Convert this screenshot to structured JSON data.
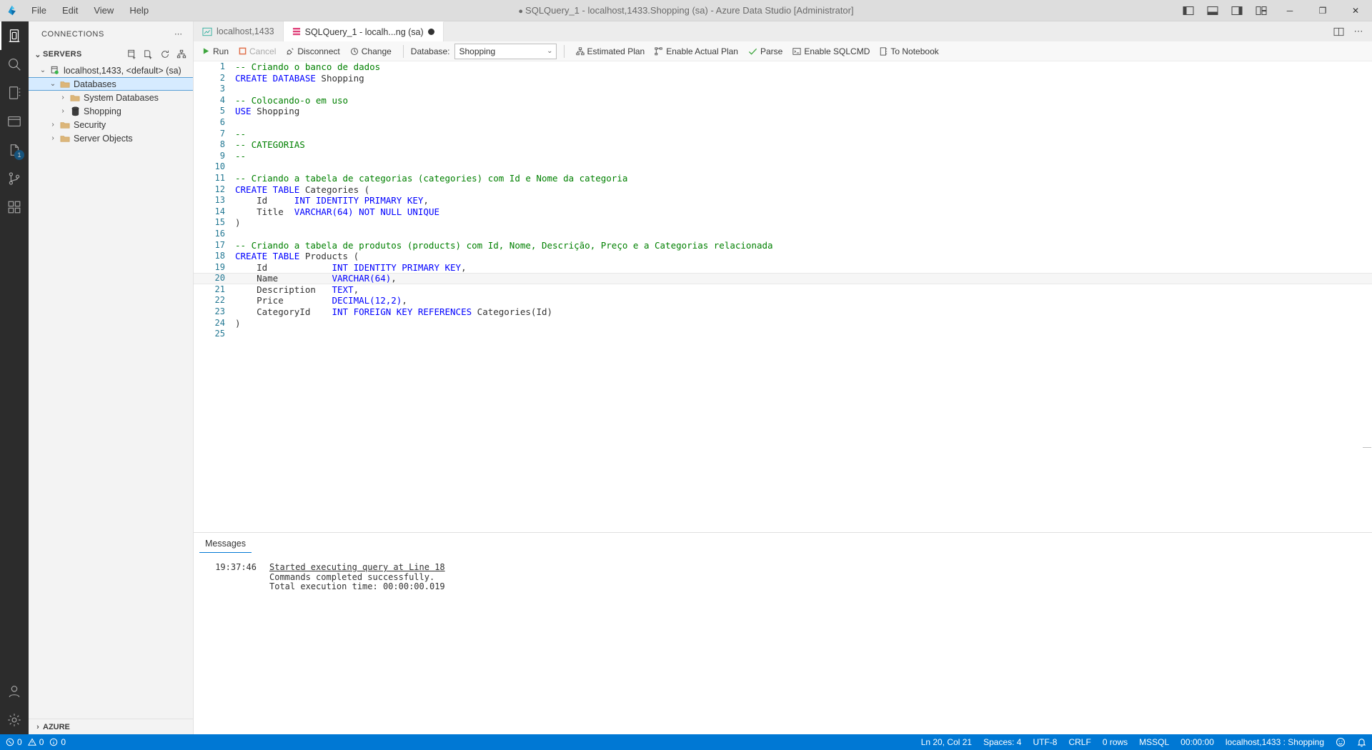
{
  "window": {
    "title": "SQLQuery_1 - localhost,1433.Shopping (sa) - Azure Data Studio [Administrator]",
    "dirty_dot": "●",
    "minimize": "─",
    "maximize": "❐",
    "close": "✕"
  },
  "menu": {
    "items": [
      {
        "label": "File"
      },
      {
        "label": "Edit"
      },
      {
        "label": "View"
      },
      {
        "label": "Help"
      }
    ]
  },
  "activitybar": {
    "items": [
      {
        "name": "servers",
        "icon": "servers-icon",
        "badge": ""
      },
      {
        "name": "search",
        "icon": "search-icon",
        "badge": ""
      },
      {
        "name": "notebooks",
        "icon": "notebook-icon",
        "badge": ""
      },
      {
        "name": "connections-explorer",
        "icon": "explorer-icon",
        "badge": ""
      },
      {
        "name": "source-control",
        "icon": "source-control-icon",
        "badge": "1"
      },
      {
        "name": "git",
        "icon": "git-branch-icon",
        "badge": ""
      },
      {
        "name": "extensions",
        "icon": "extensions-icon",
        "badge": ""
      }
    ],
    "bottom": [
      {
        "name": "accounts",
        "icon": "account-icon"
      },
      {
        "name": "settings",
        "icon": "gear-icon"
      }
    ]
  },
  "sidebar": {
    "header": "CONNECTIONS",
    "overflow": "⋯",
    "section": {
      "label": "SERVERS",
      "chevron": "⌄",
      "actions": [
        {
          "name": "new-connection-icon"
        },
        {
          "name": "new-server-group-icon"
        },
        {
          "name": "refresh-icon"
        },
        {
          "name": "view-as-tree-icon"
        }
      ]
    },
    "tree": [
      {
        "label": "localhost,1433, <default> (sa)",
        "icon": "server-icon",
        "indent": 0,
        "twisty": "⌄",
        "selected": false,
        "status": "connected"
      },
      {
        "label": "Databases",
        "icon": "folder-icon",
        "indent": 1,
        "twisty": "⌄",
        "selected": true
      },
      {
        "label": "System Databases",
        "icon": "folder-icon",
        "indent": 2,
        "twisty": "›",
        "selected": false
      },
      {
        "label": "Shopping",
        "icon": "database-icon",
        "indent": 2,
        "twisty": "›",
        "selected": false
      },
      {
        "label": "Security",
        "icon": "folder-icon",
        "indent": 1,
        "twisty": "›",
        "selected": false
      },
      {
        "label": "Server Objects",
        "icon": "folder-icon",
        "indent": 1,
        "twisty": "›",
        "selected": false
      }
    ],
    "footer": {
      "label": "AZURE",
      "chevron": "›"
    }
  },
  "tabs": [
    {
      "label": "localhost,1433",
      "icon": "dashboard-icon",
      "active": false,
      "dirty": false
    },
    {
      "label": "SQLQuery_1 - localh...ng (sa)",
      "icon": "sql-file-icon",
      "active": true,
      "dirty": true
    }
  ],
  "tabs_actions": [
    {
      "name": "split-editor-icon",
      "glyph": "◫"
    },
    {
      "name": "more-actions-icon",
      "glyph": "⋯"
    }
  ],
  "querytoolbar": {
    "run": "Run",
    "cancel": "Cancel",
    "disconnect": "Disconnect",
    "change": "Change",
    "database_label": "Database:",
    "database_value": "Shopping",
    "database_chevron": "⌄",
    "estimated_plan": "Estimated Plan",
    "enable_actual_plan": "Enable Actual Plan",
    "parse": "Parse",
    "enable_sqlcmd": "Enable SQLCMD",
    "to_notebook": "To Notebook"
  },
  "editor": {
    "current_line": 20,
    "lines": [
      {
        "n": 1,
        "tokens": [
          {
            "t": "-- Criando o banco de dados",
            "c": "cm"
          }
        ]
      },
      {
        "n": 2,
        "tokens": [
          {
            "t": "CREATE DATABASE ",
            "c": "kw"
          },
          {
            "t": "Shopping",
            "c": "id"
          }
        ]
      },
      {
        "n": 3,
        "tokens": []
      },
      {
        "n": 4,
        "tokens": [
          {
            "t": "-- Colocando-o em uso",
            "c": "cm"
          }
        ]
      },
      {
        "n": 5,
        "tokens": [
          {
            "t": "USE ",
            "c": "kw"
          },
          {
            "t": "Shopping",
            "c": "id"
          }
        ]
      },
      {
        "n": 6,
        "tokens": []
      },
      {
        "n": 7,
        "tokens": [
          {
            "t": "--",
            "c": "cm"
          }
        ]
      },
      {
        "n": 8,
        "tokens": [
          {
            "t": "-- CATEGORIAS",
            "c": "cm"
          }
        ]
      },
      {
        "n": 9,
        "tokens": [
          {
            "t": "--",
            "c": "cm"
          }
        ]
      },
      {
        "n": 10,
        "tokens": []
      },
      {
        "n": 11,
        "tokens": [
          {
            "t": "-- Criando a tabela de categorias (categories) com Id e Nome da categoria",
            "c": "cm"
          }
        ]
      },
      {
        "n": 12,
        "tokens": [
          {
            "t": "CREATE TABLE ",
            "c": "kw"
          },
          {
            "t": "Categories (",
            "c": "id"
          }
        ]
      },
      {
        "n": 13,
        "tokens": [
          {
            "t": "    Id     ",
            "c": "id"
          },
          {
            "t": "INT IDENTITY PRIMARY KEY",
            "c": "kw"
          },
          {
            "t": ",",
            "c": "id"
          }
        ]
      },
      {
        "n": 14,
        "tokens": [
          {
            "t": "    Title  ",
            "c": "id"
          },
          {
            "t": "VARCHAR(64) NOT NULL UNIQUE",
            "c": "kw"
          }
        ]
      },
      {
        "n": 15,
        "tokens": [
          {
            "t": ")",
            "c": "id"
          }
        ]
      },
      {
        "n": 16,
        "tokens": []
      },
      {
        "n": 17,
        "tokens": [
          {
            "t": "-- Criando a tabela de produtos (products) com Id, Nome, Descrição, Preço e a Categorias relacionada",
            "c": "cm"
          }
        ]
      },
      {
        "n": 18,
        "tokens": [
          {
            "t": "CREATE TABLE ",
            "c": "kw"
          },
          {
            "t": "Products (",
            "c": "id"
          }
        ]
      },
      {
        "n": 19,
        "tokens": [
          {
            "t": "    Id            ",
            "c": "id"
          },
          {
            "t": "INT IDENTITY PRIMARY KEY",
            "c": "kw"
          },
          {
            "t": ",",
            "c": "id"
          }
        ]
      },
      {
        "n": 20,
        "tokens": [
          {
            "t": "    Name          ",
            "c": "id"
          },
          {
            "t": "VARCHAR(64)",
            "c": "kw"
          },
          {
            "t": ",",
            "c": "id"
          }
        ]
      },
      {
        "n": 21,
        "tokens": [
          {
            "t": "    Description   ",
            "c": "id"
          },
          {
            "t": "TEXT",
            "c": "kw"
          },
          {
            "t": ",",
            "c": "id"
          }
        ]
      },
      {
        "n": 22,
        "tokens": [
          {
            "t": "    Price         ",
            "c": "id"
          },
          {
            "t": "DECIMAL(12,2)",
            "c": "kw"
          },
          {
            "t": ",",
            "c": "id"
          }
        ]
      },
      {
        "n": 23,
        "tokens": [
          {
            "t": "    CategoryId    ",
            "c": "id"
          },
          {
            "t": "INT FOREIGN KEY REFERENCES ",
            "c": "kw"
          },
          {
            "t": "Categories(Id)",
            "c": "id"
          }
        ]
      },
      {
        "n": 24,
        "tokens": [
          {
            "t": ")",
            "c": "id"
          }
        ]
      },
      {
        "n": 25,
        "tokens": []
      }
    ]
  },
  "results": {
    "tab": "Messages",
    "messages": [
      {
        "time": "19:37:46",
        "text": "Started executing query at Line 18",
        "link": true
      },
      {
        "time": "",
        "text": "Commands completed successfully.",
        "link": false
      },
      {
        "time": "",
        "text": "Total execution time: 00:00:00.019",
        "link": false
      }
    ]
  },
  "statusbar": {
    "errors": "0",
    "warnings": "0",
    "info": "0",
    "position": "Ln 20, Col 21",
    "spaces": "Spaces: 4",
    "encoding": "UTF-8",
    "eol": "CRLF",
    "rows": "0 rows",
    "language": "MSSQL",
    "duration": "00:00:00",
    "connection": "localhost,1433 : Shopping",
    "feedback_icon": "smiley-icon",
    "bell_icon": "bell-icon"
  }
}
